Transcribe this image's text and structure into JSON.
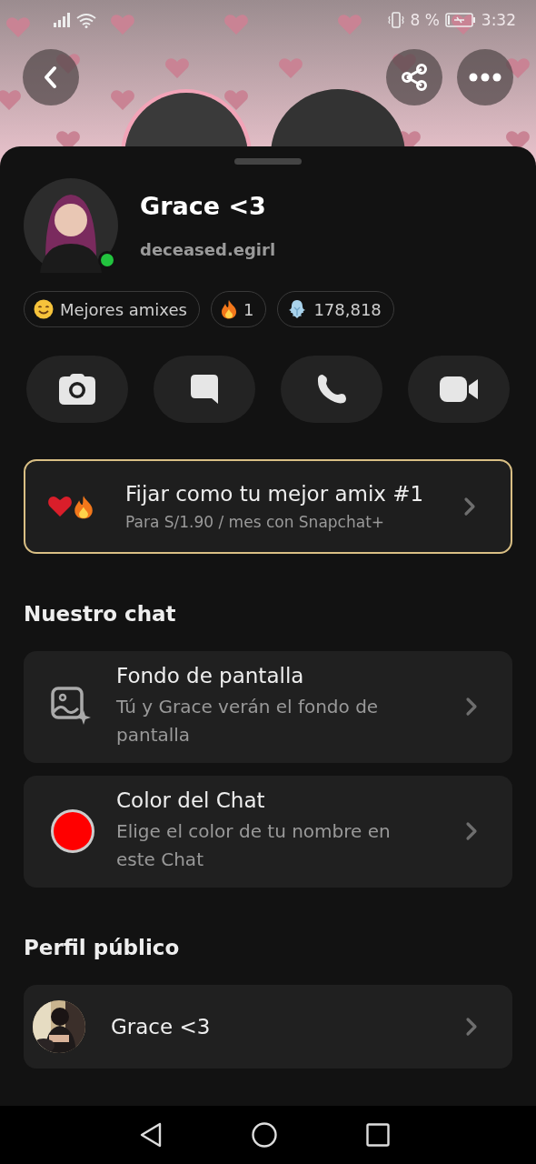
{
  "status_bar": {
    "battery": "8 %",
    "time": "3:32"
  },
  "profile": {
    "display_name": "Grace <3",
    "username": "deceased.egirl",
    "online": true
  },
  "chips": [
    {
      "kind": "smile",
      "label": "Mejores amixes"
    },
    {
      "kind": "fire",
      "label": "1"
    },
    {
      "kind": "ghost",
      "label": "178,818"
    }
  ],
  "actions": [
    {
      "kind": "camera"
    },
    {
      "kind": "chat"
    },
    {
      "kind": "call"
    },
    {
      "kind": "video"
    }
  ],
  "promo": {
    "title": "Fijar como tu mejor amix #1",
    "subtitle": "Para S/1.90 / mes con Snapchat+"
  },
  "sections": [
    {
      "title": "Nuestro chat",
      "rows": [
        {
          "kind": "wallpaper",
          "title": "Fondo de pantalla",
          "subtitle": "Tú y Grace verán el fondo de pantalla"
        },
        {
          "kind": "color",
          "title": "Color del Chat",
          "subtitle": "Elige el color de tu nombre en este Chat",
          "color": "#ff0000"
        }
      ]
    },
    {
      "title": "Perfil público",
      "rows": [
        {
          "kind": "profile",
          "title": "Grace <3"
        }
      ]
    }
  ]
}
